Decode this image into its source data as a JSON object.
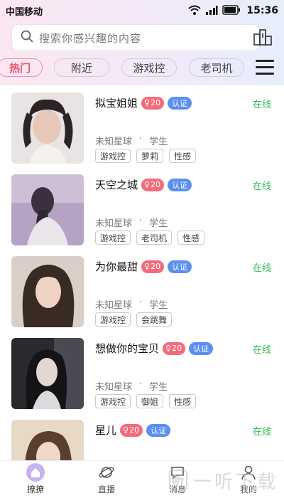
{
  "status": {
    "carrier": "中国移动",
    "time": "15:36"
  },
  "search": {
    "placeholder": "搜索你感兴趣的内容"
  },
  "tabs": [
    {
      "label": "热门",
      "active": true
    },
    {
      "label": "附近"
    },
    {
      "label": "游戏控"
    },
    {
      "label": "老司机"
    }
  ],
  "users": [
    {
      "name": "拟宝姐姐",
      "age": "20",
      "verified": "认证",
      "status": "在线",
      "location": "未知星球",
      "occupation": "学生",
      "tags": [
        "游戏控",
        "萝莉",
        "性感"
      ]
    },
    {
      "name": "天空之城",
      "age": "20",
      "verified": "认证",
      "status": "在线",
      "location": "未知星球",
      "occupation": "学生",
      "tags": [
        "游戏控",
        "老司机",
        "性感"
      ]
    },
    {
      "name": "为你最甜",
      "age": "20",
      "verified": "认证",
      "status": "在线",
      "location": "未知星球",
      "occupation": "学生",
      "tags": [
        "游戏控",
        "会跳舞"
      ]
    },
    {
      "name": "想做你的宝贝",
      "age": "20",
      "verified": "认证",
      "status": "在线",
      "location": "未知星球",
      "occupation": "学生",
      "tags": [
        "游戏控",
        "御姐",
        "性感"
      ]
    },
    {
      "name": "星儿",
      "age": "20",
      "verified": "认证",
      "status": "在线",
      "location": "",
      "occupation": "",
      "tags": []
    }
  ],
  "meta_separator": "·",
  "bottom_nav": [
    {
      "label": "撩撩",
      "icon": "home-icon",
      "active": true
    },
    {
      "label": "直播",
      "icon": "planet-icon"
    },
    {
      "label": "消息",
      "icon": "message-icon"
    },
    {
      "label": "我的",
      "icon": "profile-icon"
    }
  ],
  "watermark": {
    "mark": "听",
    "text": "一听下载"
  },
  "colors": {
    "accent": "#f0506e",
    "online": "#2fb84e",
    "verified": "#5a8ff0",
    "age_badge": "#f46b7b"
  }
}
